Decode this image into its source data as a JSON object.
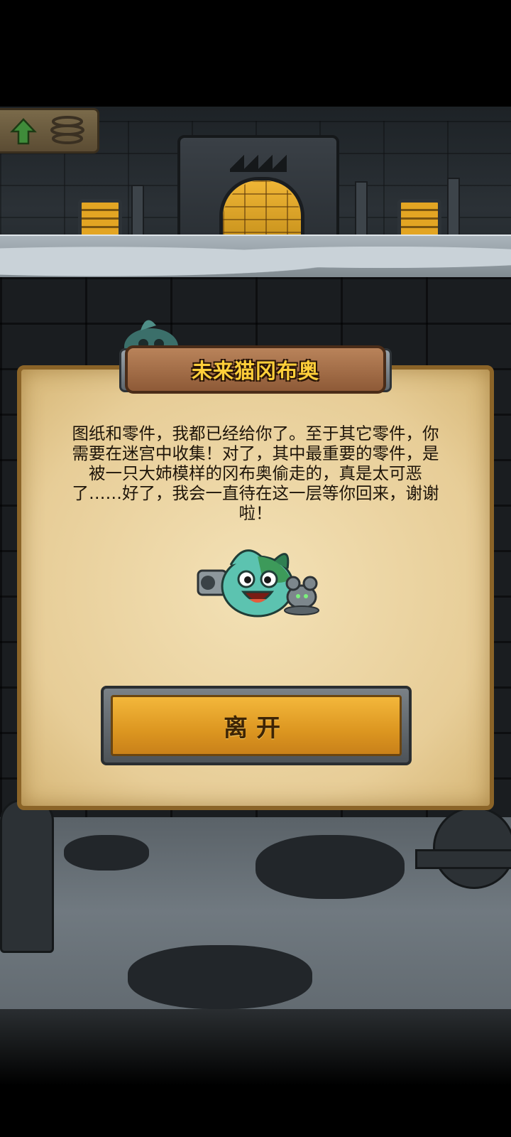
{
  "dialog": {
    "title": "未来猫冈布奥",
    "message": "图纸和零件，我都已经给你了。至于其它零件，你需要在迷宫中收集！对了，其中最重要的零件，是被一只大姉模样的冈布奥偷走的，真是太可恶了……好了，我会一直待在这一层等你回来，谢谢啦！",
    "button_label": "离开"
  },
  "icons": {
    "back": "up-arrow-icon",
    "coil": "spring-coil-icon",
    "character": "future-cat-gumball-character",
    "peek": "gumball-peeking-icon"
  },
  "colors": {
    "title_text": "#ffcf3a",
    "button": "#dc9620",
    "parchment": "#e7cd97"
  }
}
